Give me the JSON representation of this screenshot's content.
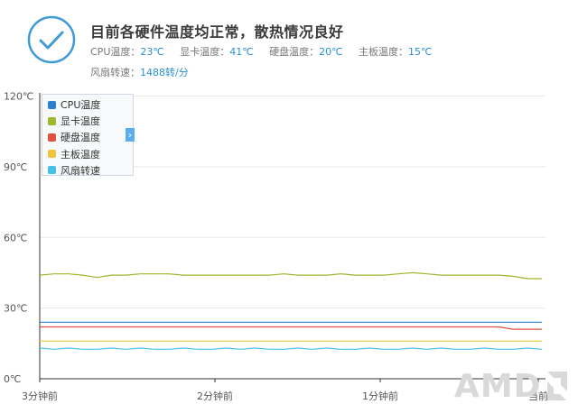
{
  "header": {
    "title": "目前各硬件温度均正常，散热情况良好",
    "temps": [
      {
        "label": "CPU温度：",
        "value": "23℃"
      },
      {
        "label": "显卡温度：",
        "value": "41℃"
      },
      {
        "label": "硬盘温度：",
        "value": "20℃"
      },
      {
        "label": "主板温度：",
        "value": "15℃"
      }
    ],
    "fan": {
      "label": "风扇转速：",
      "value": "1488转/分"
    }
  },
  "icons": {
    "status": "checkmark-circle-icon",
    "legend_toggle": "chevron-right-icon",
    "legend_toggle_glyph": "›"
  },
  "colors": {
    "accent": "#2b8fd0",
    "status_ring": "#3f9ad6"
  },
  "brand": {
    "logo_text": "AMD"
  },
  "chart_data": {
    "type": "line",
    "y_ticks": [
      "0℃",
      "30℃",
      "60℃",
      "90℃",
      "120℃"
    ],
    "x_ticks": [
      "3分钟前",
      "2分钟前",
      "1分钟前",
      "当前"
    ],
    "ylim": [
      0,
      120
    ],
    "grid": true,
    "legend_position": "top-left",
    "series": [
      {
        "name": "CPU温度",
        "color": "#2d7fd0",
        "values": [
          24,
          24,
          24,
          24,
          24,
          24,
          24,
          24,
          24,
          24,
          24,
          24,
          24,
          24,
          24,
          24,
          24,
          24,
          24,
          24,
          24,
          24,
          24,
          24,
          24,
          24,
          24,
          24,
          24,
          24,
          24,
          24,
          24,
          24,
          24,
          24
        ]
      },
      {
        "name": "显卡温度",
        "color": "#9ab82b",
        "values": [
          44,
          44.5,
          44.5,
          44,
          43,
          44,
          44,
          44.5,
          44.5,
          44.5,
          44,
          44,
          44,
          44,
          44,
          44,
          44,
          44.5,
          44,
          44,
          44,
          44.5,
          44,
          44,
          44,
          44.5,
          45,
          44.5,
          44,
          44,
          44,
          44,
          44,
          43.5,
          42.5,
          42.5
        ]
      },
      {
        "name": "硬盘温度",
        "color": "#e2503f",
        "values": [
          22,
          22,
          22,
          22,
          22,
          22,
          22,
          22,
          22,
          22,
          22,
          22,
          22,
          22,
          22,
          22,
          22,
          22,
          22,
          22,
          22,
          22,
          22,
          22,
          22,
          22,
          22,
          22,
          22,
          22,
          22,
          22,
          22,
          21,
          21,
          21
        ]
      },
      {
        "name": "主板温度",
        "color": "#f0c43a",
        "values": [
          16,
          16,
          16,
          16,
          16,
          16,
          16,
          16,
          16,
          16,
          16,
          16,
          16,
          16,
          16,
          16,
          16,
          16,
          16,
          16,
          16,
          16,
          16,
          16,
          16,
          16,
          16,
          16,
          16,
          16,
          16,
          16,
          16,
          16,
          16,
          16
        ]
      },
      {
        "name": "风扇转速",
        "color": "#45c1ec",
        "values": [
          13,
          12.5,
          13,
          12.5,
          12.5,
          13,
          12.5,
          13,
          12.5,
          12.5,
          13,
          12.5,
          12.5,
          13,
          12.5,
          13,
          12.5,
          12.5,
          13,
          12.5,
          13,
          12.5,
          12.5,
          13,
          12.5,
          12.5,
          13,
          12.5,
          13,
          12.5,
          12.5,
          13,
          12.5,
          12.5,
          13,
          12.5
        ]
      }
    ]
  }
}
